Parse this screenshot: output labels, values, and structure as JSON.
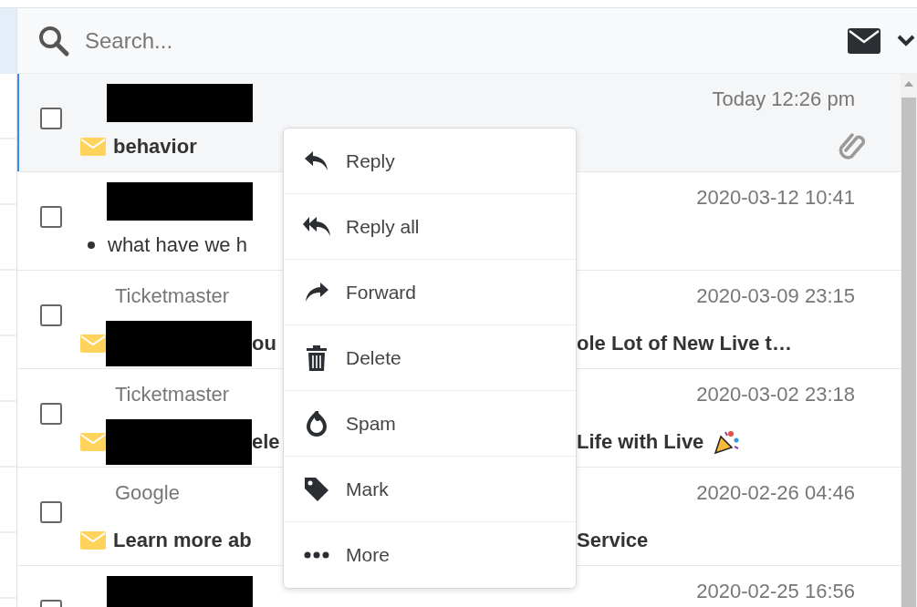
{
  "search": {
    "placeholder": "Search..."
  },
  "emails": [
    {
      "selected": true,
      "checked": false,
      "sender_hidden": true,
      "time": "Today 12:26 pm",
      "unread": true,
      "subject_hidden_start": false,
      "subject_start": "behavior",
      "attachment": true
    },
    {
      "selected": false,
      "checked": false,
      "sender_hidden": true,
      "time": "2020-03-12 10:41",
      "unread": false,
      "subject_hidden_start": false,
      "subject_start": "what have we h",
      "attachment": false
    },
    {
      "selected": false,
      "checked": false,
      "sender_hidden": false,
      "sender": "Ticketmaster",
      "time": "2020-03-09 23:15",
      "unread": true,
      "subject_hidden_start": true,
      "subject_start": "ou",
      "subject_end": "ole Lot of New Live t…",
      "attachment": false
    },
    {
      "selected": false,
      "checked": false,
      "sender_hidden": false,
      "sender": "Ticketmaster",
      "time": "2020-03-02 23:18",
      "unread": true,
      "subject_hidden_start": true,
      "subject_start": "ele",
      "subject_end": "Life with Live",
      "party_popper": true,
      "attachment": false
    },
    {
      "selected": false,
      "checked": false,
      "sender_hidden": false,
      "sender": "Google",
      "time": "2020-02-26 04:46",
      "unread": true,
      "subject_hidden_start": false,
      "subject_start": "Learn more ab",
      "subject_end": "Service",
      "attachment": false
    },
    {
      "selected": false,
      "checked": false,
      "sender_hidden": true,
      "time": "2020-02-25 16:56",
      "attachment": false
    }
  ],
  "context_menu": [
    {
      "kind": "reply",
      "label": "Reply"
    },
    {
      "kind": "reply-all",
      "label": "Reply all"
    },
    {
      "kind": "forward",
      "label": "Forward"
    },
    {
      "kind": "delete",
      "label": "Delete"
    },
    {
      "kind": "spam",
      "label": "Spam"
    },
    {
      "kind": "mark",
      "label": "Mark"
    },
    {
      "kind": "more",
      "label": "More"
    }
  ]
}
